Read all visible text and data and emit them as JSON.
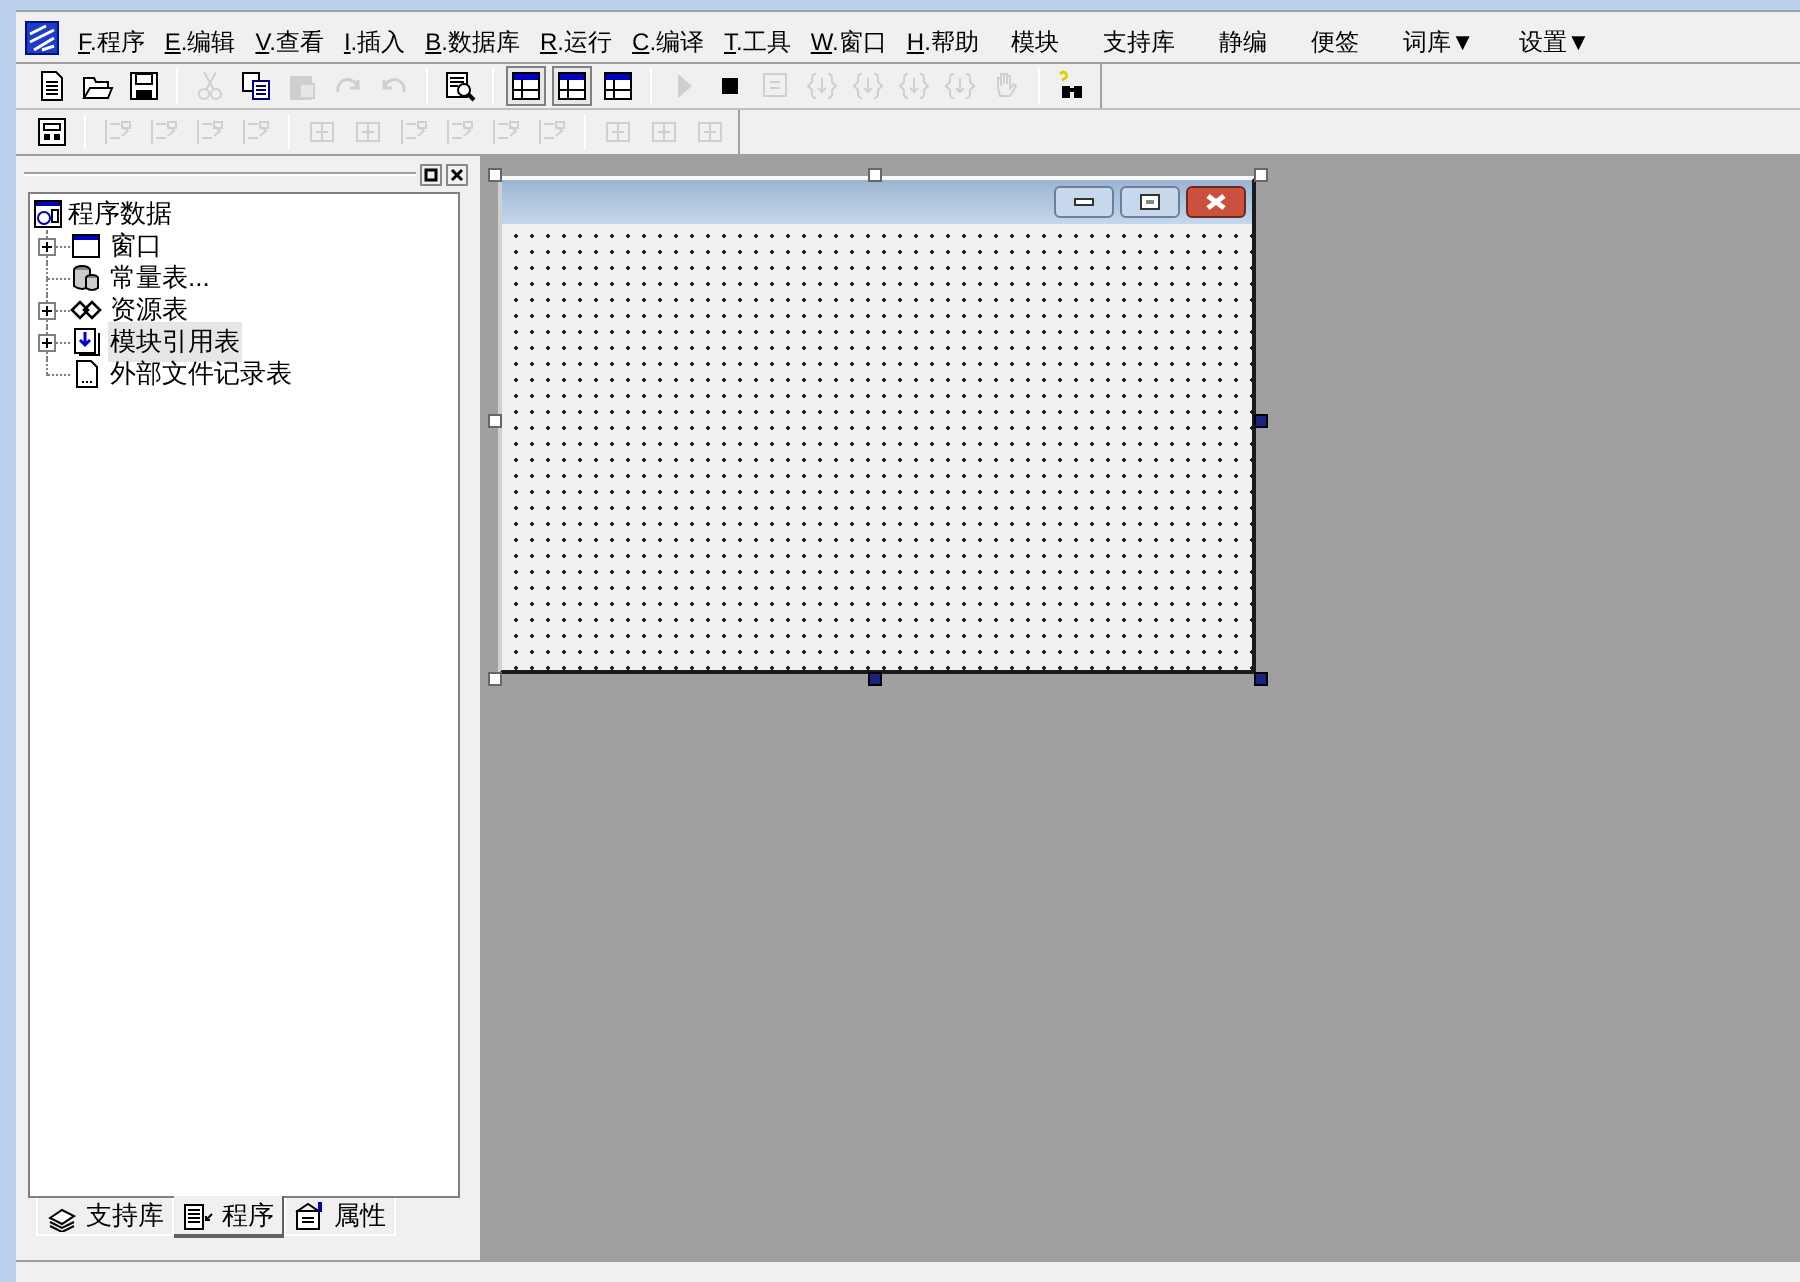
{
  "menu": [
    {
      "label": "F.程序",
      "underline_first": true
    },
    {
      "label": "E.编辑",
      "underline_first": true
    },
    {
      "label": "V.查看",
      "underline_first": true
    },
    {
      "label": "I.插入",
      "underline_first": true
    },
    {
      "label": "B.数据库",
      "underline_first": true
    },
    {
      "label": "R.运行",
      "underline_first": true
    },
    {
      "label": "C.编译",
      "underline_first": true
    },
    {
      "label": "T.工具",
      "underline_first": true
    },
    {
      "label": "W.窗口",
      "underline_first": true
    },
    {
      "label": "H.帮助",
      "underline_first": true
    },
    {
      "label": "模块",
      "underline_first": false
    },
    {
      "label": "支持库",
      "underline_first": false
    },
    {
      "label": "静编",
      "underline_first": false
    },
    {
      "label": "便签",
      "underline_first": false
    },
    {
      "label": "词库▼",
      "underline_first": false
    },
    {
      "label": "设置▼",
      "underline_first": false
    }
  ],
  "toolbar_1": [
    {
      "kind": "new",
      "disabled": false,
      "selected": false
    },
    {
      "kind": "open",
      "disabled": false,
      "selected": false
    },
    {
      "kind": "save",
      "disabled": false,
      "selected": false
    },
    {
      "kind": "separator"
    },
    {
      "kind": "cut",
      "disabled": true,
      "selected": false
    },
    {
      "kind": "copy",
      "disabled": false,
      "selected": false
    },
    {
      "kind": "paste",
      "disabled": true,
      "selected": false
    },
    {
      "kind": "redo",
      "disabled": true,
      "selected": false
    },
    {
      "kind": "undo",
      "disabled": true,
      "selected": false
    },
    {
      "kind": "separator"
    },
    {
      "kind": "find",
      "disabled": false,
      "selected": false
    },
    {
      "kind": "separator"
    },
    {
      "kind": "panel",
      "disabled": false,
      "selected": true
    },
    {
      "kind": "panel",
      "disabled": false,
      "selected": true
    },
    {
      "kind": "panel",
      "disabled": false,
      "selected": false
    },
    {
      "kind": "separator"
    },
    {
      "kind": "run",
      "disabled": true,
      "selected": false
    },
    {
      "kind": "stop",
      "disabled": false,
      "selected": false
    },
    {
      "kind": "step",
      "disabled": true,
      "selected": false
    },
    {
      "kind": "brace",
      "disabled": true,
      "selected": false
    },
    {
      "kind": "brace",
      "disabled": true,
      "selected": false
    },
    {
      "kind": "brace",
      "disabled": true,
      "selected": false
    },
    {
      "kind": "brace",
      "disabled": true,
      "selected": false
    },
    {
      "kind": "hand",
      "disabled": true,
      "selected": false
    },
    {
      "kind": "separator"
    },
    {
      "kind": "binoculars",
      "disabled": false,
      "selected": false
    }
  ],
  "toolbar_2": [
    {
      "kind": "layout",
      "disabled": false,
      "selected": false
    },
    {
      "kind": "separator"
    },
    {
      "kind": "align",
      "disabled": true,
      "selected": false
    },
    {
      "kind": "align",
      "disabled": true,
      "selected": false
    },
    {
      "kind": "align",
      "disabled": true,
      "selected": false
    },
    {
      "kind": "align",
      "disabled": true,
      "selected": false
    },
    {
      "kind": "separator"
    },
    {
      "kind": "center",
      "disabled": true,
      "selected": false
    },
    {
      "kind": "center",
      "disabled": true,
      "selected": false
    },
    {
      "kind": "align",
      "disabled": true,
      "selected": false
    },
    {
      "kind": "align",
      "disabled": true,
      "selected": false
    },
    {
      "kind": "align",
      "disabled": true,
      "selected": false
    },
    {
      "kind": "align",
      "disabled": true,
      "selected": false
    },
    {
      "kind": "separator"
    },
    {
      "kind": "center",
      "disabled": true,
      "selected": false
    },
    {
      "kind": "center",
      "disabled": true,
      "selected": false
    },
    {
      "kind": "center",
      "disabled": true,
      "selected": false
    }
  ],
  "tree": {
    "label": "程序数据",
    "children": [
      {
        "label": "窗口",
        "kind": "window",
        "has_children": true,
        "selected": false
      },
      {
        "label": "常量表...",
        "kind": "database",
        "has_children": false,
        "selected": false
      },
      {
        "label": "资源表",
        "kind": "resource",
        "has_children": true,
        "selected": false
      },
      {
        "label": "模块引用表",
        "kind": "module",
        "has_children": true,
        "selected": true
      },
      {
        "label": "外部文件记录表",
        "kind": "file",
        "has_children": false,
        "selected": false
      }
    ]
  },
  "panel_tabs": [
    {
      "label": "支持库",
      "selected": false
    },
    {
      "label": "程序",
      "selected": true
    },
    {
      "label": "属性",
      "selected": false
    }
  ]
}
